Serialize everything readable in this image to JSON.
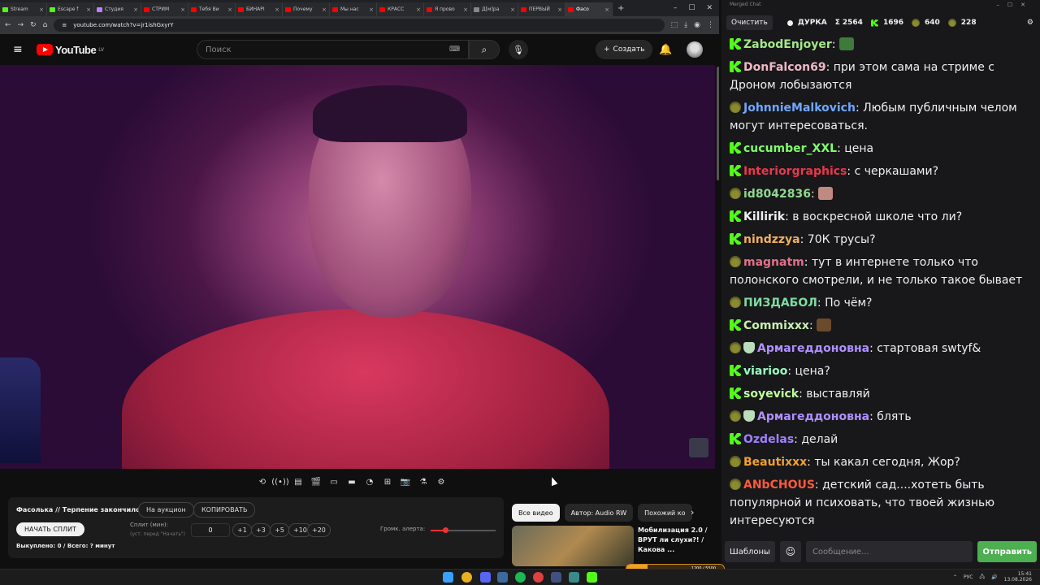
{
  "browser": {
    "tabs": [
      {
        "label": "Stream",
        "color": "#53fc18"
      },
      {
        "label": "Escape f",
        "color": "#53fc18"
      },
      {
        "label": "Студия",
        "color": "#c080ff"
      },
      {
        "label": "СТРИМ",
        "color": "#ff0000"
      },
      {
        "label": "Тебя Ви",
        "color": "#ff0000"
      },
      {
        "label": "БИНАРІ",
        "color": "#ff0000"
      },
      {
        "label": "Почему",
        "color": "#ff0000"
      },
      {
        "label": "Мы нас",
        "color": "#ff0000"
      },
      {
        "label": "КРАСС",
        "color": "#ff0000"
      },
      {
        "label": "Я прово",
        "color": "#ff0000"
      },
      {
        "label": "Д[м]ра",
        "color": "#888888"
      },
      {
        "label": "ПЕРВЫЙ",
        "color": "#ff0000"
      },
      {
        "label": "Фасо",
        "color": "#ff0000",
        "active": true
      }
    ],
    "url": "youtube.com/watch?v=jr1ishGxyrY"
  },
  "youtube": {
    "logo": "YouTube",
    "region": "LV",
    "search_placeholder": "Поиск",
    "create_label": "Создать"
  },
  "panel": {
    "title": "Фасолька // Терпение закончилось",
    "auction_btn": "На аукцион",
    "copy_btn": "КОПИРОВАТЬ",
    "start_split_btn": "НАЧАТЬ СПЛИТ",
    "split_label": "Сплит (мин):",
    "split_hint": "(уст. перед \"Начать\")",
    "split_value": "0",
    "increments": [
      "+1",
      "+3",
      "+5",
      "+10",
      "+20"
    ],
    "volume_label": "Громк. алерта:",
    "volume_level": 0.22,
    "bought": "Выкуплено: 0 / Всего: ? минут"
  },
  "chips": [
    "Все видео",
    "Автор: Audio RW",
    "Похожий ко"
  ],
  "recommendation": {
    "title": "Мобилизация 2.0 / ВРУТ ли слухи?! / Какова ..."
  },
  "progress": {
    "label": "1200 / 5500",
    "fraction": 0.22
  },
  "taskbar": {
    "lang": "РУС",
    "time": "15:41",
    "date": "13.08.2026"
  },
  "chat": {
    "window_title": "Merged Chat",
    "clear_btn": "Очистить",
    "channel": "ДУРКА",
    "stats": [
      {
        "icon": "Σ",
        "value": "2564"
      },
      {
        "icon": "K",
        "value": "1696"
      },
      {
        "icon": "pepe",
        "value": "640"
      },
      {
        "icon": "pepe2",
        "value": "228"
      }
    ],
    "messages": [
      {
        "badges": [
          "k"
        ],
        "user": "ZabodEnjoyer",
        "color": "#a5e887",
        "text": "",
        "emote": "#3e7a3a"
      },
      {
        "badges": [
          "k"
        ],
        "user": "DonFalcon69",
        "color": "#f2b7c6",
        "text": "при этом сама на стриме с Дроном лобызаются"
      },
      {
        "badges": [
          "pepe"
        ],
        "user": "JohnnieMalkovich",
        "color": "#6fa8ff",
        "text": "Любым публичным челом могут интересоваться."
      },
      {
        "badges": [
          "k"
        ],
        "user": "cucumber_XXL",
        "color": "#7fff6a",
        "text": "цена"
      },
      {
        "badges": [
          "k"
        ],
        "user": "Interiorgraphics",
        "color": "#e8384b",
        "text": "с черкашами?"
      },
      {
        "badges": [
          "pepe"
        ],
        "user": "id8042836",
        "color": "#8fd98f",
        "text": "",
        "emote": "#c08a80"
      },
      {
        "badges": [
          "k"
        ],
        "user": "Killirik",
        "color": "#f0f0f0",
        "text": "в воскресной школе что ли?"
      },
      {
        "badges": [
          "k"
        ],
        "user": "nindzzya",
        "color": "#f0b060",
        "text": "70К трусы?"
      },
      {
        "badges": [
          "pepe"
        ],
        "user": "magnatm",
        "color": "#e0708a",
        "text": "тут в интернете только что полонского смотрели, и не только такое бывает"
      },
      {
        "badges": [
          "pepe"
        ],
        "user": "ПИЗДАБОЛ",
        "color": "#7fdba0",
        "text": "По чём?"
      },
      {
        "badges": [
          "k"
        ],
        "user": "Commixxx",
        "color": "#c8f0b0",
        "text": "",
        "emote": "#6a4a2a"
      },
      {
        "badges": [
          "pepe",
          "shield"
        ],
        "user": "Армагеддоновна",
        "color": "#b090ff",
        "text": "стартовая swtyf&"
      },
      {
        "badges": [
          "k"
        ],
        "user": "viarioo",
        "color": "#9affc0",
        "text": "цена?"
      },
      {
        "badges": [
          "k"
        ],
        "user": "soyevick",
        "color": "#c0ffa0",
        "text": "выставляй"
      },
      {
        "badges": [
          "pepe",
          "shield"
        ],
        "user": "Армагеддоновна",
        "color": "#b090ff",
        "text": "блять"
      },
      {
        "badges": [
          "k"
        ],
        "user": "Ozdelas",
        "color": "#a080ff",
        "text": "делай"
      },
      {
        "badges": [
          "pepe"
        ],
        "user": "Beautixxx",
        "color": "#f0a030",
        "text": "ты какал сегодня, Жор?"
      },
      {
        "badges": [
          "pepe"
        ],
        "user": "ANbCHOUS",
        "color": "#ff5a3a",
        "text": "детский сад....хотеть быть популярной и психовать, что твоей жизнью интересуются"
      }
    ],
    "templates_btn": "Шаблоны",
    "message_placeholder": "Сообщение...",
    "send_btn": "Отправить"
  }
}
